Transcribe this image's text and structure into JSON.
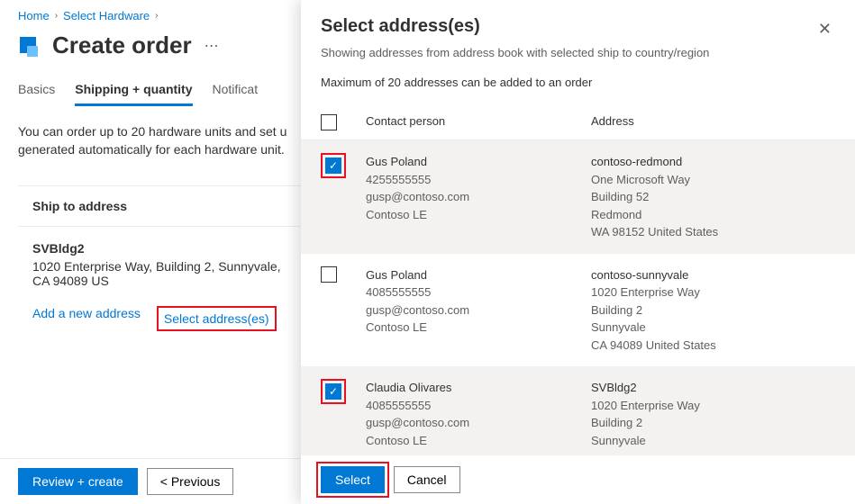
{
  "breadcrumb": {
    "home": "Home",
    "hw": "Select Hardware"
  },
  "page": {
    "title": "Create order"
  },
  "tabs": {
    "basics": "Basics",
    "shipping": "Shipping + quantity",
    "notif": "Notificat"
  },
  "body": {
    "line1": "You can order up to 20 hardware units and set u",
    "line2": "generated automatically for each hardware unit."
  },
  "shipHeader": "Ship to address",
  "shipTo": {
    "name": "SVBldg2",
    "line": "1020 Enterprise Way, Building 2, Sunnyvale,",
    "cityzip": "CA 94089 US"
  },
  "links": {
    "add": "Add a new address",
    "select": "Select address(es)"
  },
  "footer": {
    "review": "Review + create",
    "prev": "< Previous"
  },
  "panel": {
    "title": "Select address(es)",
    "sub": "Showing addresses from address book with selected ship to country/region",
    "note": "Maximum of 20 addresses can be added to an order",
    "colContact": "Contact person",
    "colAddr": "Address",
    "selectBtn": "Select",
    "cancelBtn": "Cancel"
  },
  "rows": [
    {
      "c0": "Gus Poland",
      "c1": "4255555555",
      "c2": "gusp@contoso.com",
      "c3": "Contoso LE",
      "a0": "contoso-redmond",
      "a1": "One Microsoft Way",
      "a2": "Building 52",
      "a3": "Redmond",
      "a4": "WA 98152 United States"
    },
    {
      "c0": "Gus Poland",
      "c1": "4085555555",
      "c2": "gusp@contoso.com",
      "c3": "Contoso LE",
      "a0": "contoso-sunnyvale",
      "a1": "1020 Enterprise Way",
      "a2": "Building 2",
      "a3": "Sunnyvale",
      "a4": "CA 94089 United States"
    },
    {
      "c0": "Claudia Olivares",
      "c1": "4085555555",
      "c2": "gusp@contoso.com",
      "c3": "Contoso LE",
      "a0": "SVBldg2",
      "a1": "1020 Enterprise Way",
      "a2": "Building 2",
      "a3": "Sunnyvale",
      "a4": ""
    }
  ]
}
